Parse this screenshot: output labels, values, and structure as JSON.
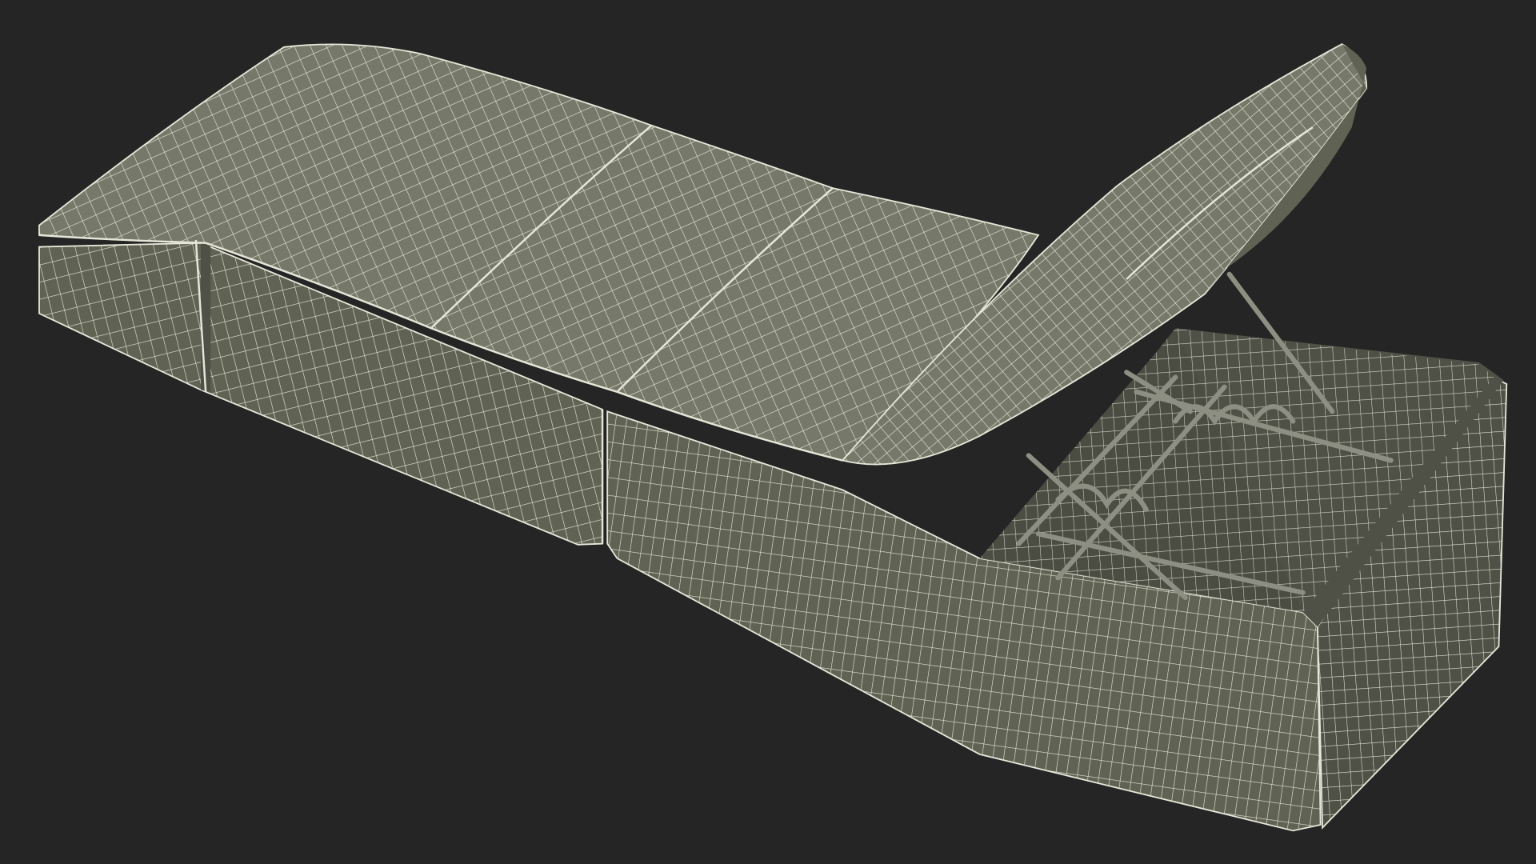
{
  "scene": {
    "subject": "wireframe-sun-lounger",
    "colors": {
      "background": "#252525",
      "surface": "#76786a",
      "surface_shade": "#606254",
      "surface_dark": "#4f5146",
      "wire": "#e6e6d8",
      "frame": "#8d8f82"
    },
    "icons": []
  }
}
